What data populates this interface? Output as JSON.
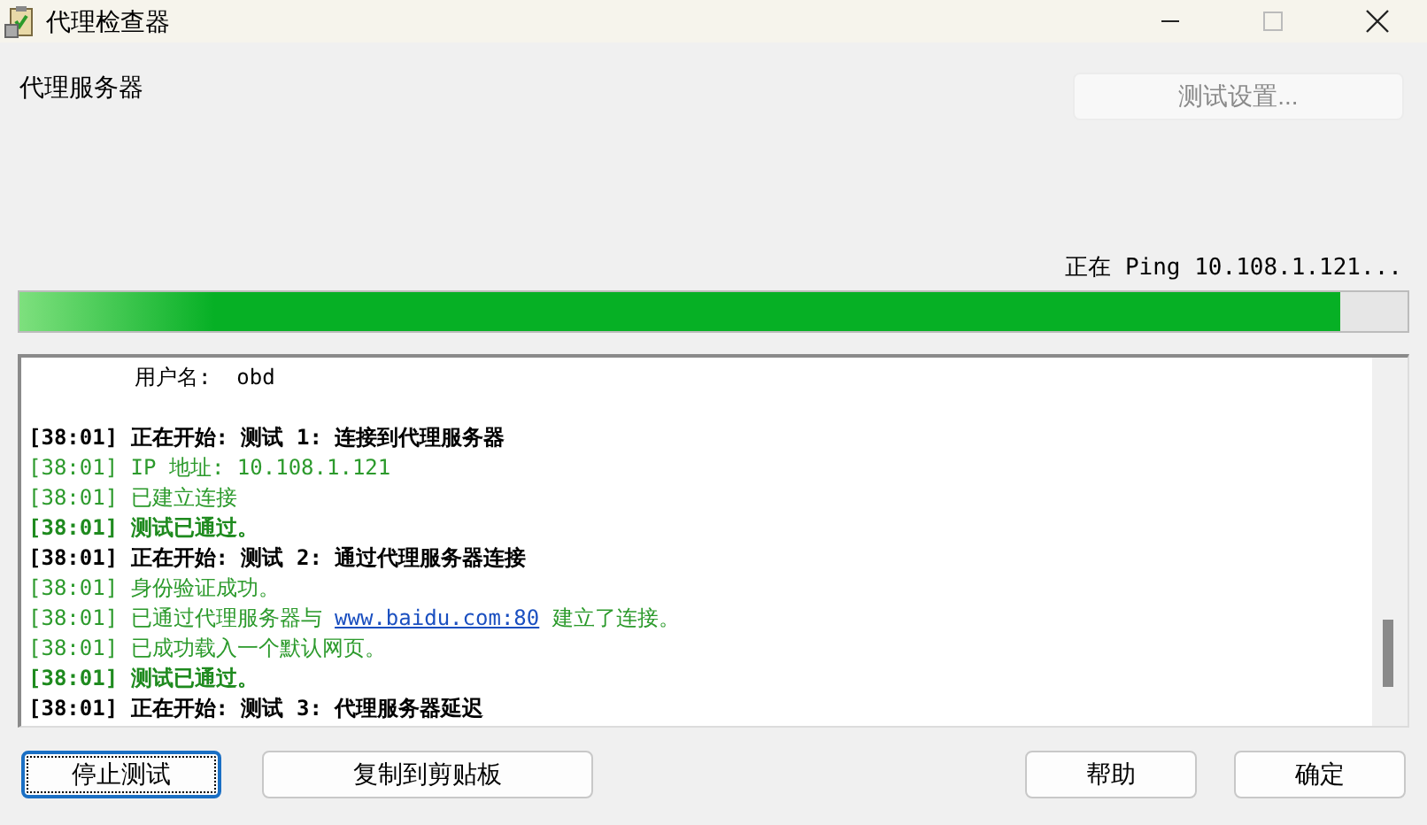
{
  "window": {
    "title": "代理检查器"
  },
  "section_label": "代理服务器",
  "settings_button": {
    "label": "测试设置...",
    "disabled": true
  },
  "status": "正在 Ping 10.108.1.121...",
  "progress": {
    "level": 0.951
  },
  "log": [
    {
      "kind": "plain",
      "text": "用户名:  obd"
    },
    {
      "kind": "blank"
    },
    {
      "kind": "header",
      "text": "[38:01] 正在开始: 测试 1: 连接到代理服务器"
    },
    {
      "kind": "info",
      "text": "[38:01] IP 地址: 10.108.1.121"
    },
    {
      "kind": "info",
      "text": "[38:01] 已建立连接"
    },
    {
      "kind": "pass",
      "text": "[38:01] 测试已通过。"
    },
    {
      "kind": "header",
      "text": "[38:01] 正在开始: 测试 2: 通过代理服务器连接"
    },
    {
      "kind": "info",
      "text": "[38:01] 身份验证成功。"
    },
    {
      "kind": "info",
      "text": "[38:01] 已通过代理服务器与 ",
      "link": "www.baidu.com:80",
      "after": " 建立了连接。"
    },
    {
      "kind": "info",
      "text": "[38:01] 已成功载入一个默认网页。"
    },
    {
      "kind": "pass",
      "text": "[38:01] 测试已通过。"
    },
    {
      "kind": "header",
      "text": "[38:01] 正在开始: 测试 3: 代理服务器延迟"
    }
  ],
  "buttons_left": [
    {
      "label": "停止测试",
      "focused": true
    },
    {
      "label": "复制到剪贴板",
      "focused": false
    }
  ],
  "buttons_right": [
    {
      "label": "帮助",
      "focused": false
    },
    {
      "label": "确定",
      "focused": false
    }
  ]
}
